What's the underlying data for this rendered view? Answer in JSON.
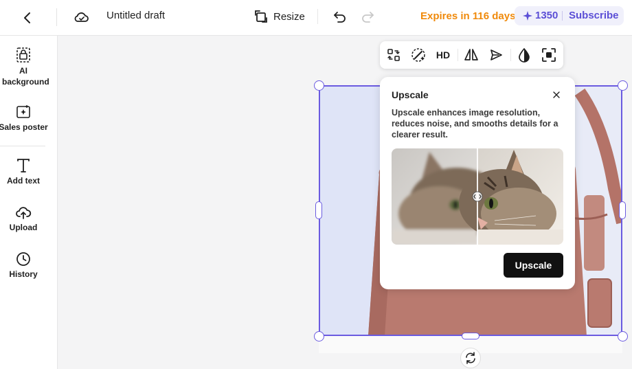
{
  "topbar": {
    "title": "Untitled draft",
    "resize_label": "Resize",
    "expires_text": "Expires in 116 days",
    "credits": "1350",
    "subscribe_label": "Subscribe"
  },
  "sidebar": {
    "items": [
      {
        "label": "AI background",
        "icon": "ai-background-icon"
      },
      {
        "label": "Sales poster",
        "icon": "sales-poster-icon"
      },
      {
        "label": "Add text",
        "icon": "text-icon"
      },
      {
        "label": "Upload",
        "icon": "upload-icon"
      },
      {
        "label": "History",
        "icon": "history-icon"
      }
    ]
  },
  "toolbar": {
    "hd_label": "HD"
  },
  "popover": {
    "title": "Upscale",
    "description": "Upscale enhances image resolution, reduces noise, and smooths details for a clearer result.",
    "button_label": "Upscale"
  },
  "colors": {
    "accent": "#6a5ae0",
    "expires": "#f08a0b",
    "credits": "#5b4fd6",
    "bag": "#b97a6f"
  }
}
